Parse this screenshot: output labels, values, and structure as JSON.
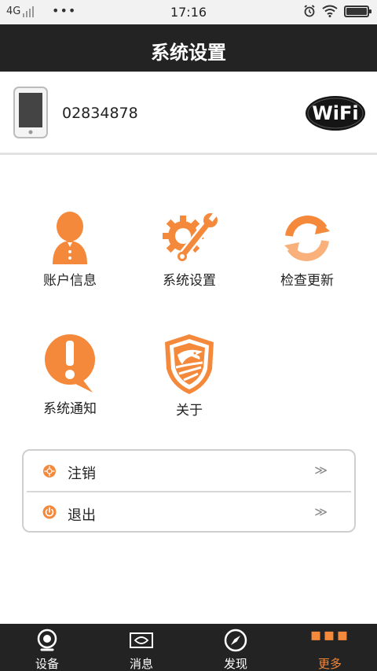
{
  "status_bar": {
    "network": "4G",
    "menu_dots": "•••",
    "time": "17:16"
  },
  "header": {
    "title": "系统设置"
  },
  "device": {
    "id": "02834878",
    "badge_text": "WiFi"
  },
  "grid": [
    {
      "label": "账户信息",
      "icon": "user-icon"
    },
    {
      "label": "系统设置",
      "icon": "gear-wrench-icon"
    },
    {
      "label": "检查更新",
      "icon": "refresh-icon"
    },
    {
      "label": "系统通知",
      "icon": "exclamation-bubble-icon"
    },
    {
      "label": "关于",
      "icon": "eagle-shield-icon"
    }
  ],
  "actions": [
    {
      "label": "注销",
      "chevron": "≫",
      "icon": "logout-dot-icon"
    },
    {
      "label": "退出",
      "chevron": "≫",
      "icon": "power-icon"
    }
  ],
  "nav": [
    {
      "label": "设备",
      "icon": "camera-icon",
      "active": false
    },
    {
      "label": "消息",
      "icon": "message-icon",
      "active": false
    },
    {
      "label": "发现",
      "icon": "compass-icon",
      "active": false
    },
    {
      "label": "更多",
      "icon": "more-dots-icon",
      "active": true
    }
  ],
  "colors": {
    "accent": "#f5893b",
    "bar_bg": "#232323"
  }
}
